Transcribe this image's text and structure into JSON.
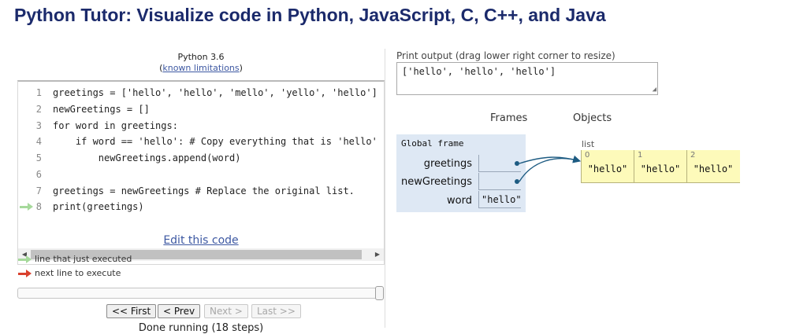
{
  "header": {
    "title": "Python Tutor: Visualize code in Python, JavaScript, C, C++, and Java"
  },
  "editor": {
    "language": "Python 3.6",
    "limitations_link": "known limitations",
    "current_line": 8,
    "lines": [
      {
        "num": "1",
        "code": "greetings = ['hello', 'hello', 'mello', 'yello', 'hello']"
      },
      {
        "num": "2",
        "code": "newGreetings = []"
      },
      {
        "num": "3",
        "code": "for word in greetings:"
      },
      {
        "num": "4",
        "code": "    if word == 'hello': # Copy everything that is 'hello'"
      },
      {
        "num": "5",
        "code": "        newGreetings.append(word)"
      },
      {
        "num": "6",
        "code": ""
      },
      {
        "num": "7",
        "code": "greetings = newGreetings # Replace the original list."
      },
      {
        "num": "8",
        "code": "print(greetings)"
      }
    ],
    "edit_link": "Edit this code"
  },
  "legend": {
    "just_executed": "line that just executed",
    "next_line": "next line to execute",
    "just_executed_color": "#a6d99b",
    "next_line_color": "#d9412e"
  },
  "navigation": {
    "slider_progress": 1.0,
    "first": "<< First",
    "prev": "< Prev",
    "next": "Next >",
    "last": "Last >>",
    "step_text": "Done running (18 steps)"
  },
  "output": {
    "label": "Print output (drag lower right corner to resize)",
    "text": "['hello', 'hello', 'hello']"
  },
  "viz": {
    "frames_header": "Frames",
    "objects_header": "Objects",
    "global_frame": {
      "title": "Global frame",
      "vars": [
        {
          "name": "greetings",
          "value": ""
        },
        {
          "name": "newGreetings",
          "value": ""
        },
        {
          "name": "word",
          "value": "\"hello\""
        }
      ]
    },
    "list": {
      "label": "list",
      "items": [
        {
          "index": "0",
          "value": "\"hello\""
        },
        {
          "index": "1",
          "value": "\"hello\""
        },
        {
          "index": "2",
          "value": "\"hello\""
        }
      ]
    },
    "frame_color": "#dee8f4",
    "list_color": "#fdfaba",
    "pointer_color": "#1d5b82"
  }
}
